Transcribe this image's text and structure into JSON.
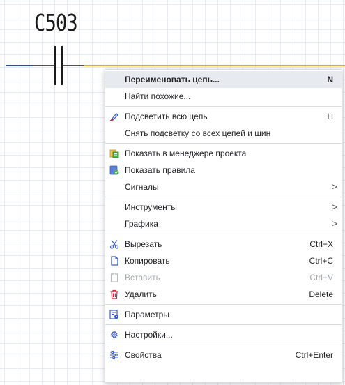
{
  "schematic": {
    "reference_label": "C503"
  },
  "context_menu": {
    "rename": {
      "label": "Переименовать цепь...",
      "shortcut": "N"
    },
    "find_similar": {
      "label": "Найти похожие..."
    },
    "highlight_net": {
      "label": "Подсветить всю цепь",
      "shortcut": "H",
      "icon": "highlight-pen-icon"
    },
    "clear_highlight": {
      "label": "Снять подсветку со всех цепей и шин"
    },
    "show_in_manager": {
      "label": "Показать в менеджере проекта",
      "icon": "project-manager-icon"
    },
    "show_rules": {
      "label": "Показать правила",
      "icon": "rules-icon"
    },
    "signals": {
      "label": "Сигналы",
      "submenu": ">"
    },
    "tools": {
      "label": "Инструменты",
      "submenu": ">"
    },
    "graphics": {
      "label": "Графика",
      "submenu": ">"
    },
    "cut": {
      "label": "Вырезать",
      "shortcut": "Ctrl+X",
      "icon": "scissors-icon"
    },
    "copy": {
      "label": "Копировать",
      "shortcut": "Ctrl+C",
      "icon": "copy-icon"
    },
    "paste": {
      "label": "Вставить",
      "shortcut": "Ctrl+V",
      "icon": "paste-icon",
      "disabled": true
    },
    "delete": {
      "label": "Удалить",
      "shortcut": "Delete",
      "icon": "trash-icon"
    },
    "parameters": {
      "label": "Параметры",
      "icon": "parameters-icon"
    },
    "settings": {
      "label": "Настройки...",
      "icon": "gear-icon"
    },
    "properties": {
      "label": "Свойства",
      "shortcut": "Ctrl+Enter",
      "icon": "sliders-icon"
    }
  },
  "colors": {
    "wire_left": "#2b3fd1",
    "wire_right": "#f0a020",
    "delete_icon": "#d7263d"
  }
}
